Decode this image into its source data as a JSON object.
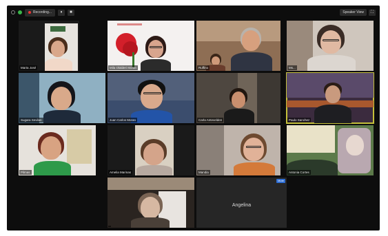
{
  "topbar": {
    "recording_label": "Recording...",
    "pause_icon": "pause-icon",
    "stop_icon": "stop-icon",
    "view_label": "Speaker View",
    "fullscreen_icon": "fullscreen-icon"
  },
  "participants": [
    {
      "name": "Marta José"
    },
    {
      "name": "Mila Olalderi Moran"
    },
    {
      "name": "Ruffino"
    },
    {
      "name": "Ms..."
    },
    {
      "name": "Sugara Sevilan"
    },
    {
      "name": "Juan Carlos Moran"
    },
    {
      "name": "Carla Antevelden"
    },
    {
      "name": "Paulo Sanchez"
    },
    {
      "name": "Pilmas"
    },
    {
      "name": "Amelia Marinas"
    },
    {
      "name": "Mandia"
    },
    {
      "name": "Antonia Cortes"
    },
    {
      "name": ""
    },
    {
      "name": "Angelina"
    }
  ],
  "angelina_tag": "Mute",
  "colors": {
    "window_bg": "#0d0d0d",
    "active_outline": "#c6c13a",
    "recording_dot": "#e33333"
  }
}
